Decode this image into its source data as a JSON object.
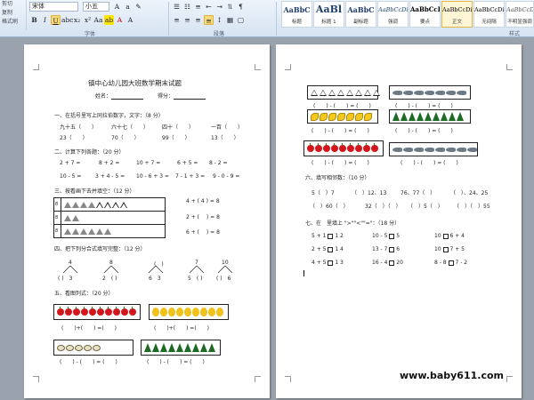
{
  "ribbon": {
    "clipboard": [
      "剪切",
      "复制",
      "格式刷"
    ],
    "font_name": "宋体",
    "font_size": "小五",
    "group_font": "字体",
    "group_paragraph": "段落",
    "group_styles": "样式",
    "styles": [
      {
        "sample": "AaBbC",
        "name": "标题"
      },
      {
        "sample": "AaBl",
        "name": "标题 1"
      },
      {
        "sample": "AaBbC",
        "name": "副标题"
      },
      {
        "sample": "AaBbCcDi",
        "name": "强调"
      },
      {
        "sample": "AaBbCcD",
        "name": "要点"
      },
      {
        "sample": "AaBbCcDi",
        "name": "正文"
      },
      {
        "sample": "AaBbCcDi",
        "name": "无间隔"
      },
      {
        "sample": "AaBbCcDi",
        "name": "不明显强调"
      }
    ]
  },
  "page1": {
    "title": "镇中心幼儿园大班数学期末试题",
    "name_label": "姓名：",
    "score_label": "得分：",
    "s1": "一、在括号里写上同拉伯数字，文字：（8 分）",
    "s1_row1": [
      "九十五（　　）",
      "六十七（　　）",
      "四十（　　）",
      "一百（　　）"
    ],
    "s1_row2": [
      "23（　　）",
      "70（　　）",
      "99（　　）",
      "13（　　）"
    ],
    "s2": "二、计算下列各题：（20 分）",
    "s2_row1": [
      "2 + 7 =",
      "8 + 2 =",
      "10 + 7 =",
      "6 + 5 =",
      "8 - 2 ="
    ],
    "s2_row2": [
      "10 - 5 =",
      "3 + 4 - 5 =",
      "10 - 6 + 3 =",
      "7 - 1 + 3 =",
      "9 - 0 - 9 ="
    ],
    "s3": "三、按看画下去并填空：（12 分）",
    "s3_eq": [
      "4 + ( 4 ) = 8",
      "2 + (　 ) = 8",
      "6 + (　 ) = 8"
    ],
    "s3_rows": [
      "8",
      "8",
      "8"
    ],
    "s4": "四、把下列分合式填写完整：（12 分）",
    "s4_tops": [
      "4",
      "8",
      "(　)",
      "7",
      "10"
    ],
    "s4_bottoms": [
      "( )　3",
      "2　( )",
      "6　3",
      "5　( )",
      "( )　6"
    ],
    "s5": "五、看图列式：（20 分）",
    "eq_blank": "(　　)+(　　) =(　　)",
    "eq_blank_minus": "(　　) - (　　) = (　　)"
  },
  "page2": {
    "s6": "六、填写相邻数：（10 分）",
    "s6_row1": [
      "5（　）7",
      "（　）12、13",
      "76、77（　）",
      "（　）、24、25"
    ],
    "s6_row2": [
      "（　）60（　）",
      "32（　）（　）",
      "（　）5（　）",
      "（　）（　）55"
    ],
    "s7": "七、在　里填上 \">\"\"<\"\"=\"：（18 分）",
    "s7_rows": [
      [
        "5 + 1",
        "1 2",
        "10 - 5",
        "5",
        "10",
        "6 + 4"
      ],
      [
        "2 + 5",
        "1 4",
        "13 - 7",
        "6",
        "10",
        "7 + 5"
      ],
      [
        "4 + 5",
        "1 3",
        "16 - 4",
        "20",
        "8 - 8",
        "7 - 2"
      ]
    ]
  },
  "watermark": "www.baby611.com",
  "colors": {
    "ribbon_top": "#eef4fb",
    "ribbon_bottom": "#d6e3f2",
    "background": "#9aa3ad",
    "apple": "#d4151b",
    "tree": "#1d6b25"
  }
}
